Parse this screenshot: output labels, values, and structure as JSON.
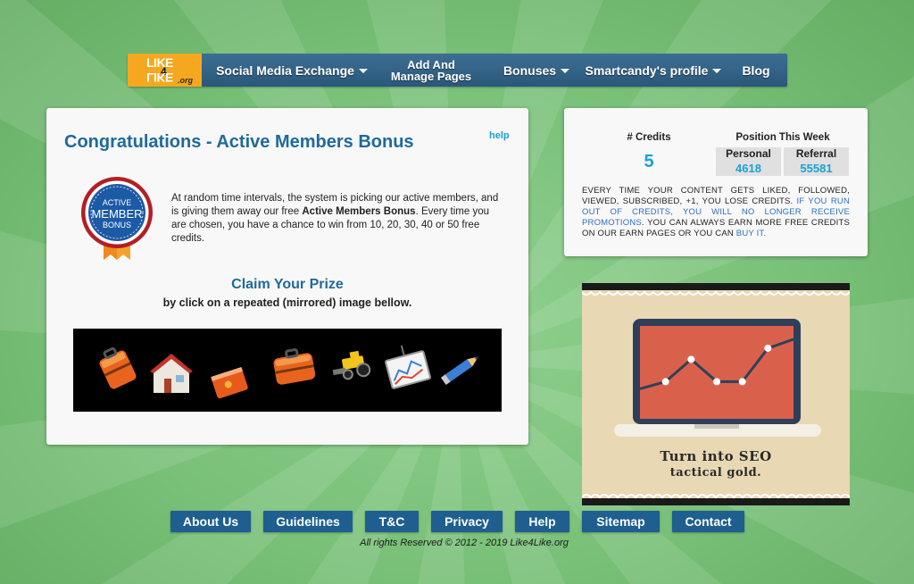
{
  "nav": {
    "logo": {
      "top": "LIKE",
      "num": "4",
      "bottom": "LIKE",
      "tld": ".org"
    },
    "items": [
      {
        "label": "Social Media Exchange"
      },
      {
        "line1": "Add And",
        "line2": "Manage Pages"
      },
      {
        "label": "Bonuses"
      },
      {
        "label": "Smartcandy's profile"
      },
      {
        "label": "Blog"
      }
    ]
  },
  "main": {
    "title": "Congratulations - Active Members Bonus",
    "help": "help",
    "badge": {
      "line1": "ACTIVE",
      "line2": "MEMBER",
      "line3": "BONUS"
    },
    "intro_before": "At random time intervals, the system is picking our active members, and is giving them away our free ",
    "intro_bold": "Active Members Bonus",
    "intro_after": ". Every time you are chosen, you have a chance to win from 10, 20, 30, 40 or 50 free credits.",
    "claim_title": "Claim Your Prize",
    "claim_sub": "by click on a repeated (mirrored) image bellow.",
    "prizes": [
      "briefcase",
      "house",
      "book",
      "briefcase",
      "tractor",
      "chart-board",
      "pencil"
    ]
  },
  "credits": {
    "label": "# Credits",
    "value": "5",
    "position_label": "Position This Week",
    "personal_label": "Personal",
    "personal_value": "4618",
    "referral_label": "Referral",
    "referral_value": "55581",
    "text1": "EVERY TIME YOUR CONTENT GETS LIKED, FOLLOWED, VIEWED, SUBSCRIBED, +1, YOU LOSE CREDITS. ",
    "text_link1": "IF YOU RUN OUT OF CREDITS, YOU WILL NO LONGER RECEIVE PROMOTIONS",
    "text2": ". YOU CAN ALWAYS EARN MORE FREE CREDITS ON OUR EARN PAGES OR YOU CAN ",
    "text_link2": "BUY IT."
  },
  "ad": {
    "line1": "Turn into SEO",
    "line2": "tactical gold.",
    "chart_points": [
      2,
      3.2,
      2,
      2,
      3.8
    ]
  },
  "footer": {
    "links": [
      "About Us",
      "Guidelines",
      "T&C",
      "Privacy",
      "Help",
      "Sitemap",
      "Contact"
    ],
    "copyright": "All rights Reserved © 2012 - 2019 Like4Like.org"
  },
  "colors": {
    "nav": "#2a577a",
    "accent": "#1ba0d6",
    "title": "#1f6a99",
    "logo": "#f5a81f",
    "footer_button": "#1e5f8f"
  }
}
